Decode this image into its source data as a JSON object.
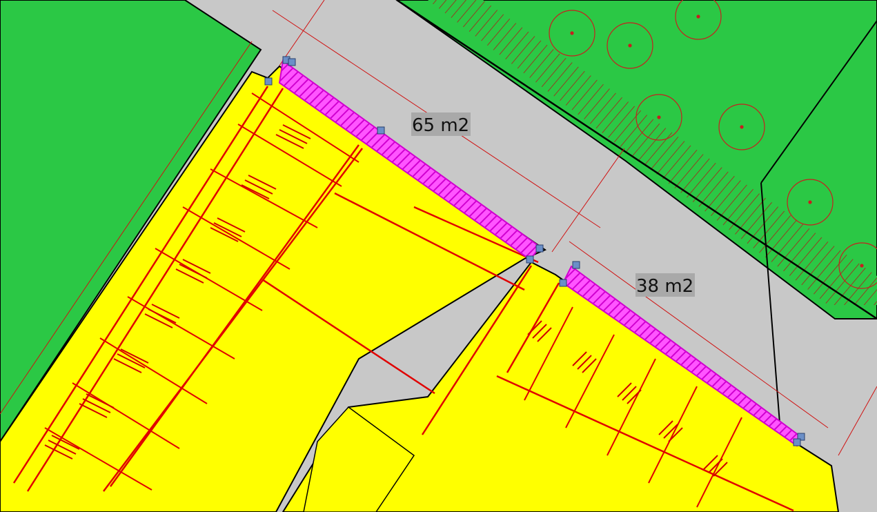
{
  "map": {
    "area_labels": [
      {
        "id": "area-north",
        "text": "65 m2"
      },
      {
        "id": "area-south",
        "text": "38 m2"
      }
    ],
    "colors": {
      "background_street": "#c8c8c8",
      "green_zone": "#2bc845",
      "building_zone": "#ffff00",
      "hatched_area": "#ff33ff",
      "plan_lines": "#e00000",
      "outline": "#000000",
      "handle": "#6b8fc7",
      "label_bg": "#a9a9a9"
    }
  }
}
